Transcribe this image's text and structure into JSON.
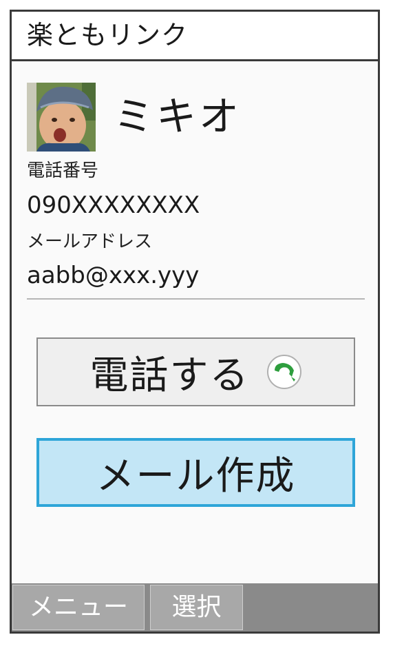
{
  "header": {
    "title": "楽ともリンク"
  },
  "contact": {
    "name": "ミキオ",
    "phone_label": "電話番号",
    "phone_value": "090XXXXXXXX",
    "email_label": "メールアドレス",
    "email_value": "aabb@xxx.yyy",
    "avatar": "child-photo"
  },
  "actions": {
    "call_label": "電話する",
    "call_icon": "phone-icon",
    "mail_label": "メール作成"
  },
  "softkeys": {
    "menu": "メニュー",
    "select": "選択"
  },
  "colors": {
    "frame_border": "#3a3a3a",
    "selected_fill": "#c3e6f6",
    "selected_border": "#2ea5d8",
    "phone_icon_green": "#2e9e3e",
    "softbar": "#8a8a8a"
  }
}
